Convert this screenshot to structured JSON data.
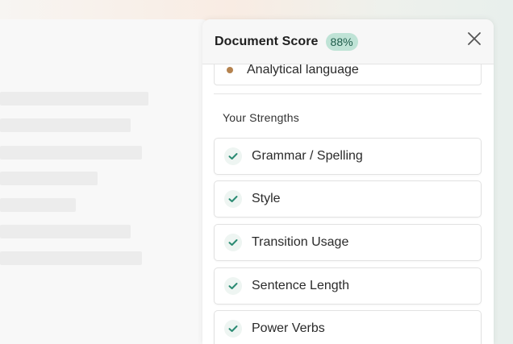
{
  "panel": {
    "title": "Document Score",
    "score": "88%",
    "close_icon": "close-icon"
  },
  "weakness_item": {
    "label": "Analytical language",
    "dot_color": "#b5834f"
  },
  "strengths": {
    "section_title": "Your Strengths",
    "check_color": "#2a8a72",
    "items": [
      {
        "label": "Grammar / Spelling",
        "icon": "check-icon"
      },
      {
        "label": "Style",
        "icon": "check-icon"
      },
      {
        "label": "Transition Usage",
        "icon": "check-icon"
      },
      {
        "label": "Sentence Length",
        "icon": "check-icon"
      },
      {
        "label": "Power Verbs",
        "icon": "check-icon"
      }
    ]
  }
}
